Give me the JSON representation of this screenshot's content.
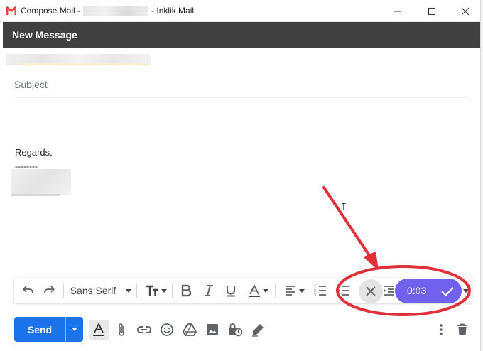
{
  "window": {
    "title_prefix": "Compose Mail -",
    "title_suffix": "- Inklik Mail"
  },
  "compose": {
    "header_title": "New Message",
    "subject_placeholder": "Subject",
    "signature": {
      "regards": "Regards,",
      "dashes": "--------"
    }
  },
  "toolbar": {
    "font_family": "Sans Serif"
  },
  "recording": {
    "timer": "0:03"
  },
  "bottom_bar": {
    "send_label": "Send"
  },
  "colors": {
    "header_bg": "#404040",
    "send_blue": "#1a73e8",
    "record_purple": "#7161ef",
    "annotation_red": "#e0303a",
    "gmail_red": "#ea4335"
  },
  "icons": {
    "toolbar": [
      "undo-icon",
      "redo-icon",
      "font-size-icon",
      "bold-icon",
      "italic-icon",
      "underline-icon",
      "text-color-icon",
      "align-icon",
      "numbered-list-icon",
      "bulleted-list-icon",
      "indent-icon",
      "more-options-icon"
    ],
    "bottom": [
      "formatting-options-icon",
      "attach-icon",
      "insert-link-icon",
      "emoji-icon",
      "drive-icon",
      "photo-icon",
      "confidential-mode-icon",
      "signature-icon",
      "more-icon",
      "trash-icon"
    ]
  }
}
